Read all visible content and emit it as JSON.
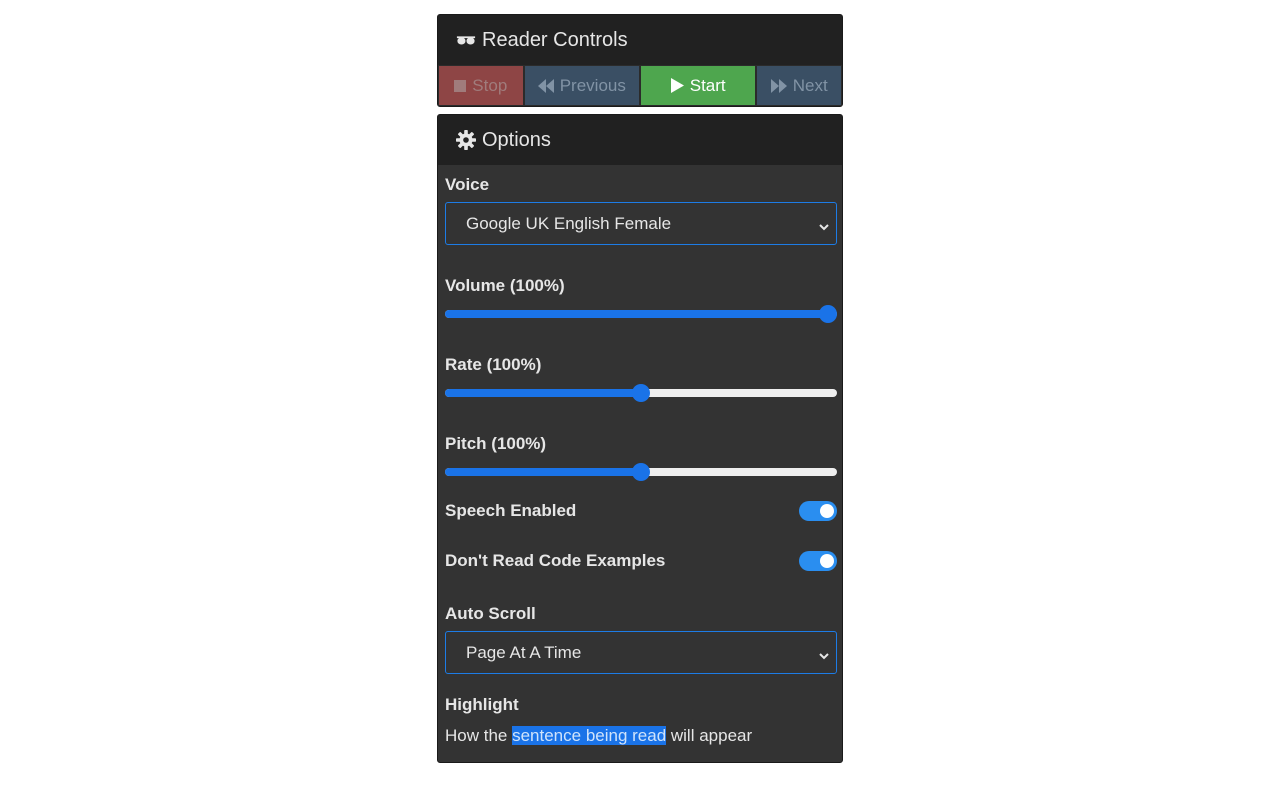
{
  "reader": {
    "title": "Reader Controls",
    "title_icon": "glasses-icon",
    "buttons": {
      "stop": {
        "label": "Stop",
        "icon": "stop-icon"
      },
      "previous": {
        "label": "Previous",
        "icon": "backward-icon"
      },
      "start": {
        "label": "Start",
        "icon": "play-icon"
      },
      "next": {
        "label": "Next",
        "icon": "forward-icon"
      }
    }
  },
  "options": {
    "title": "Options",
    "title_icon": "gear-icon",
    "voice": {
      "label": "Voice",
      "value": "Google UK English Female"
    },
    "volume": {
      "label": "Volume (100%)",
      "value_fraction": 1.0
    },
    "rate": {
      "label": "Rate (100%)",
      "value_fraction": 0.5
    },
    "pitch": {
      "label": "Pitch (100%)",
      "value_fraction": 0.5
    },
    "speech_enabled": {
      "label": "Speech Enabled",
      "on": true
    },
    "skip_code": {
      "label": "Don't Read Code Examples",
      "on": true
    },
    "auto_scroll": {
      "label": "Auto Scroll",
      "value": "Page At A Time"
    },
    "highlight": {
      "label": "Highlight",
      "before": "How the ",
      "marked": "sentence being read",
      "after": " will appear"
    }
  },
  "colors": {
    "panel_bg": "#333333",
    "header_bg": "#212121",
    "accent": "#1a73e8",
    "stop_bg": "#8e4545",
    "start_bg": "#4ea64e",
    "nav_bg": "#3a4f64"
  }
}
